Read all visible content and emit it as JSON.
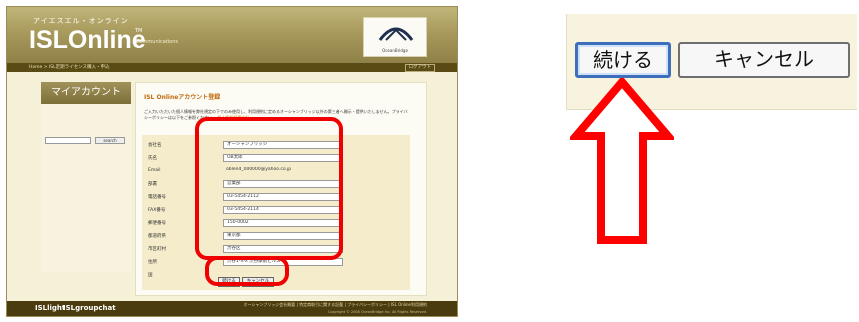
{
  "left_screenshot": {
    "banner": {
      "kana": "アイエスエル・オンライン",
      "brand": "ISLOnline",
      "tm": "TM",
      "tagline": "Communications",
      "partner_logo_caption": "OceanBridge"
    },
    "navbar": {
      "left_text": "Home > ISL定期ライセンス購入・申込",
      "right_text": "ログアウト"
    },
    "sidebar": {
      "title": "マイアカウント",
      "search_button": "search"
    },
    "content": {
      "title": "ISL Onlineアカウント登録",
      "description": "ご入力いただいた個人情報を弊社規定の下でのみ使用し、利用規約に定めるオーシャンブリッジ以外の第三者へ開示・提供いたしません。プライバシーポリシーは以下をご参照ください。",
      "description_link": "個人情報保護方針"
    },
    "form": {
      "fields": [
        {
          "label": "会社名",
          "value": "オーシャンブリッジ"
        },
        {
          "label": "氏名",
          "value": "OB太郎"
        },
        {
          "label": "Email",
          "value": "oblend_000000@yahoo.co.jp"
        },
        {
          "label": "部署",
          "value": "営業部"
        },
        {
          "label": "電話番号",
          "value": "03-5454-2112"
        },
        {
          "label": "FAX番号",
          "value": "03-5454-2114"
        },
        {
          "label": "郵便番号",
          "value": "150-0002"
        },
        {
          "label": "都道府県",
          "value": "東京都"
        },
        {
          "label": "市区町村",
          "value": "渋谷区"
        },
        {
          "label": "住所",
          "value": "渋谷1-X-X 渋谷駅前ビル5F"
        },
        {
          "label": "国",
          "value": ""
        }
      ],
      "continue_button": "続ける",
      "cancel_button": "キャンセル"
    },
    "footer": {
      "logo_left": "ISLlight",
      "logo_right": "ISLgroupchat",
      "links": "オーシャンブリッジ会社概要 | 特定商取引に関する記載 | プライバシーポリシー | ISL Online利用規約",
      "copyright": "Copyright © 2008 OceanBridge Inc. All Rights Reserved."
    }
  },
  "zoom_view": {
    "continue_button": "続ける",
    "cancel_button": "キャンセル"
  },
  "colors": {
    "highlight": "#f00000",
    "banner": "#a89a5c",
    "page_bg": "#f5f0d8",
    "focused_border": "#3f6ebd"
  },
  "icons": [
    "arrow-up-icon",
    "bridge-logo-icon"
  ]
}
